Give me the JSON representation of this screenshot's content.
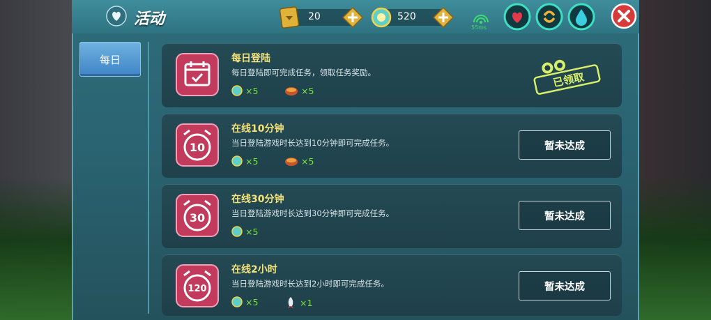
{
  "header": {
    "title": "活动",
    "ticket_count": "20",
    "coin_count": "520",
    "ping": "55ms"
  },
  "sidebar": {
    "items": [
      {
        "label": "每日"
      }
    ]
  },
  "tasks": [
    {
      "title": "每日登陆",
      "description": "每日登陆即可完成任务，领取任务奖励。",
      "icon_text": "",
      "rewards": [
        {
          "icon": "coin-icon",
          "amount": "×5"
        },
        {
          "icon": "food-icon",
          "amount": "×5"
        }
      ],
      "status": "已领取"
    },
    {
      "title": "在线10分钟",
      "description": "当日登陆游戏时长达到10分钟即可完成任务。",
      "icon_text": "10",
      "rewards": [
        {
          "icon": "coin-icon",
          "amount": "×5"
        },
        {
          "icon": "food-icon",
          "amount": "×5"
        }
      ],
      "status": "暂未达成"
    },
    {
      "title": "在线30分钟",
      "description": "当日登陆游戏时长达到30分钟即可完成任务。",
      "icon_text": "30",
      "rewards": [
        {
          "icon": "coin-icon",
          "amount": "×5"
        }
      ],
      "status": "暂未达成"
    },
    {
      "title": "在线2小时",
      "description": "当日登陆游戏时长达到2小时即可完成任务。",
      "icon_text": "120",
      "rewards": [
        {
          "icon": "coin-icon",
          "amount": "×5"
        },
        {
          "icon": "rocket-icon",
          "amount": "×1"
        }
      ],
      "status": "暂未达成"
    }
  ],
  "colors": {
    "accent": "#f3e27a",
    "reward": "#7ee04a",
    "panel": "#2a6270"
  }
}
